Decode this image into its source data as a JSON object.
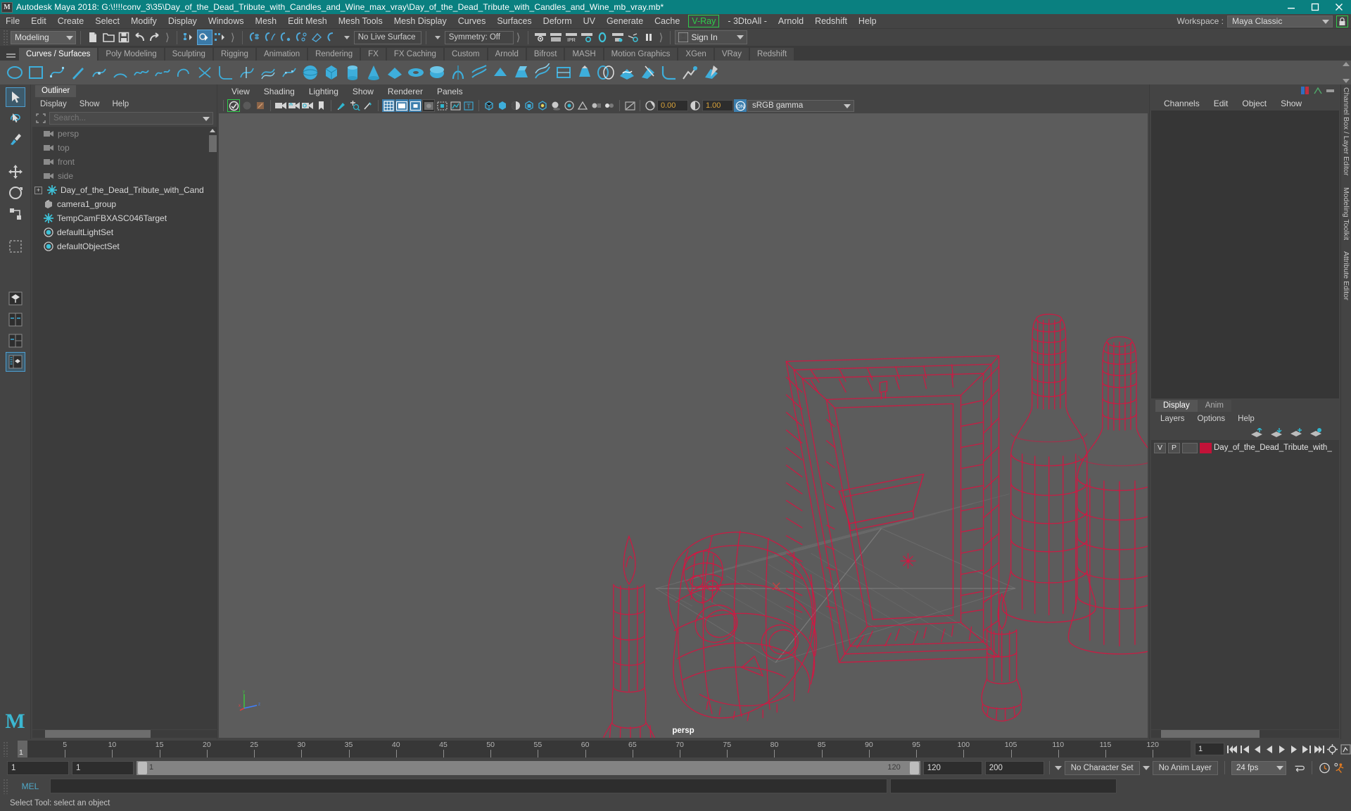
{
  "titlebar": {
    "app_title": "Autodesk Maya 2018: G:\\!!!!conv_3\\35\\Day_of_the_Dead_Tribute_with_Candles_and_Wine_max_vray\\Day_of_the_Dead_Tribute_with_Candles_and_Wine_mb_vray.mb*",
    "logo": "M",
    "minimize": "minimize-icon",
    "maximize": "maximize-icon",
    "close": "close-icon"
  },
  "menubar": {
    "items": [
      "File",
      "Edit",
      "Create",
      "Select",
      "Modify",
      "Display",
      "Windows",
      "Mesh",
      "Edit Mesh",
      "Mesh Tools",
      "Mesh Display",
      "Curves",
      "Surfaces",
      "Deform",
      "UV",
      "Generate",
      "Cache"
    ],
    "vray": "V-Ray",
    "after_vray": [
      "- 3DtoAll -",
      "Arnold",
      "Redshift",
      "Help"
    ],
    "workspace_label": "Workspace :",
    "workspace_value": "Maya Classic",
    "lock_icon": "lock-icon"
  },
  "statusbar": {
    "mode": "Modeling",
    "live_surface": "No Live Surface",
    "symmetry": "Symmetry: Off",
    "signin": "Sign In"
  },
  "shelf": {
    "tabs": [
      "Curves / Surfaces",
      "Poly Modeling",
      "Sculpting",
      "Rigging",
      "Animation",
      "Rendering",
      "FX",
      "FX Caching",
      "Custom",
      "Arnold",
      "Bifrost",
      "MASH",
      "Motion Graphics",
      "XGen",
      "VRay",
      "Redshift"
    ],
    "active_tab": "Curves / Surfaces"
  },
  "outliner": {
    "tab": "Outliner",
    "menus": [
      "Display",
      "Show",
      "Help"
    ],
    "search_placeholder": "Search...",
    "items": [
      {
        "label": "persp",
        "icon": "camera-icon",
        "dim": true,
        "expandable": false
      },
      {
        "label": "top",
        "icon": "camera-icon",
        "dim": true,
        "expandable": false
      },
      {
        "label": "front",
        "icon": "camera-icon",
        "dim": true,
        "expandable": false
      },
      {
        "label": "side",
        "icon": "camera-icon",
        "dim": true,
        "expandable": false
      },
      {
        "label": "Day_of_the_Dead_Tribute_with_Cand",
        "icon": "transform-icon",
        "dim": false,
        "expandable": true
      },
      {
        "label": "camera1_group",
        "icon": "group-icon",
        "dim": false,
        "expandable": false
      },
      {
        "label": "TempCamFBXASC046Target",
        "icon": "transform-icon",
        "dim": false,
        "expandable": false
      },
      {
        "label": "defaultLightSet",
        "icon": "set-icon",
        "dim": false,
        "expandable": false
      },
      {
        "label": "defaultObjectSet",
        "icon": "set-icon",
        "dim": false,
        "expandable": false
      }
    ]
  },
  "viewport": {
    "menus": [
      "View",
      "Shading",
      "Lighting",
      "Show",
      "Renderer",
      "Panels"
    ],
    "exposure": "0.00",
    "gamma_value": "1.00",
    "color_management": "sRGB gamma",
    "camera_label": "persp",
    "wireframe_color": "#e01040"
  },
  "channelbox": {
    "menus": [
      "Channels",
      "Edit",
      "Object",
      "Show"
    ],
    "vertical_tabs": [
      "Channel Box / Layer Editor",
      "Modeling Toolkit",
      "Attribute Editor"
    ]
  },
  "layers": {
    "tabs": [
      "Display",
      "Anim"
    ],
    "active_tab": "Display",
    "menus": [
      "Layers",
      "Options",
      "Help"
    ],
    "rows": [
      {
        "visible": "V",
        "playback": "P",
        "color": "#c21238",
        "name": "Day_of_the_Dead_Tribute_with_"
      }
    ]
  },
  "timeline": {
    "current_frame": "1",
    "tick_labels": [
      "5",
      "10",
      "15",
      "20",
      "25",
      "30",
      "35",
      "40",
      "45",
      "50",
      "55",
      "60",
      "65",
      "70",
      "75",
      "80",
      "85",
      "90",
      "95",
      "100",
      "105",
      "110",
      "115",
      "120"
    ],
    "playback_field": "1"
  },
  "range": {
    "start": "1",
    "anim_start": "1",
    "range_start_label": "1",
    "range_end_label": "120",
    "range_end": "120",
    "anim_end": "200",
    "character_set": "No Character Set",
    "anim_layer": "No Anim Layer",
    "fps": "24 fps"
  },
  "command": {
    "language": "MEL",
    "input_value": "",
    "status_text": "Select Tool: select an object"
  }
}
